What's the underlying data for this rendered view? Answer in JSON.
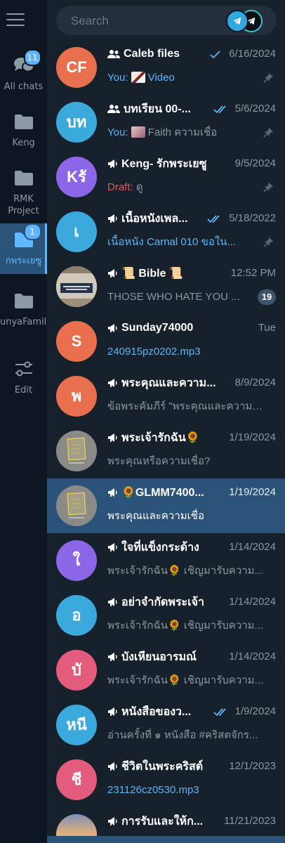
{
  "search": {
    "placeholder": "Search"
  },
  "folders": [
    {
      "label": "All chats",
      "icon": "chats-icon",
      "badge": "11"
    },
    {
      "label": "Keng",
      "icon": "folder-icon"
    },
    {
      "label": "RMK Project",
      "icon": "folder-icon"
    },
    {
      "label": "กพระเยซู",
      "icon": "folder-icon",
      "badge": "1",
      "active": true
    },
    {
      "label": "unyaFamily",
      "icon": "folder-icon"
    },
    {
      "label": "Edit",
      "icon": "sliders-icon"
    }
  ],
  "chats": [
    {
      "avatar": "CF",
      "color": "#e8704f",
      "icon": "group",
      "name": "Caleb files",
      "date": "6/16/2024",
      "ticks": "single",
      "sender": "You: ",
      "preview": "Video",
      "preview_style": "blue",
      "has_thumb": true,
      "pinned": true
    },
    {
      "avatar": "บท",
      "color": "#3ba9dc",
      "icon": "group",
      "name": "บทเรียน 00-...",
      "date": "5/6/2024",
      "ticks": "double",
      "sender": "You: ",
      "preview": "Faith ความเชื่อ",
      "has_thumb": true,
      "pinned": true
    },
    {
      "avatar": "Kรั",
      "color": "#8b66e6",
      "icon": "channel",
      "name": "Keng- รักพระเยซู",
      "date": "9/5/2024",
      "draft": "Draft: ",
      "preview": "ดู",
      "pinned": true
    },
    {
      "avatar": "เ",
      "color": "#3ba9dc",
      "icon": "channel",
      "name": "เนื้อหนังเพล...",
      "date": "5/18/2022",
      "ticks": "double",
      "preview": "เนื้อหนัง Carnal 010 ขอใน...",
      "preview_style": "blue",
      "pinned": true
    },
    {
      "avatar": "",
      "color": "#d8d6cf",
      "icon": "channel",
      "name": "📜 Bible 📜",
      "date": "12:52 PM",
      "preview": "THOSE WHO HATE YOU ...",
      "badge": "19",
      "image": "bible"
    },
    {
      "avatar": "S",
      "color": "#e8704f",
      "icon": "channel",
      "name": "Sunday74000",
      "date": "Tue",
      "preview": "240915pz0202.mp3",
      "preview_style": "blue"
    },
    {
      "avatar": "พ",
      "color": "#e8704f",
      "icon": "channel",
      "name": "พระคุณและความ...",
      "date": "8/9/2024",
      "preview": "ข้อพระคัมภีร์ \"พระคุณและความเชื่...\""
    },
    {
      "avatar": "",
      "color": "#7a7a7a",
      "icon": "channel",
      "name": "พระเจ้ารักฉัน🌻",
      "date": "1/19/2024",
      "preview": "พระคุณหรือความเชื่อ?",
      "image": "godbless"
    },
    {
      "avatar": "",
      "color": "#7a7a7a",
      "icon": "channel",
      "name": "🌻GLMM7400...",
      "date": "1/19/2024",
      "preview": "พระคุณและความเชื่อ",
      "image": "godbless",
      "selected": true
    },
    {
      "avatar": "ใ",
      "color": "#8b66e6",
      "icon": "channel",
      "name": "ใจที่แข็งกระด้าง",
      "date": "1/14/2024",
      "preview": "พระเจ้ารักฉัน🌻 เชิญมารับความ..."
    },
    {
      "avatar": "อ",
      "color": "#3ba9dc",
      "icon": "channel",
      "name": "อย่าจำกัดพระเจ้า",
      "date": "1/14/2024",
      "preview": "พระเจ้ารักฉัน🌻 เชิญมารับความ..."
    },
    {
      "avatar": "บั",
      "color": "#e35c7e",
      "icon": "channel",
      "name": "บังเหียนอารมณ์",
      "date": "1/14/2024",
      "preview": "พระเจ้ารักฉัน🌻 เชิญมารับความ..."
    },
    {
      "avatar": "หนี",
      "color": "#3ba9dc",
      "icon": "channel",
      "name": "หนังสือของว...",
      "date": "1/9/2024",
      "ticks": "double",
      "preview": "อ่านครั้งที่ ๑ หนังสือ #คริสตจักร..."
    },
    {
      "avatar": "ชี",
      "color": "#e35c7e",
      "icon": "channel",
      "name": "ชีวิตในพระคริสต์",
      "date": "12/1/2023",
      "preview": "231126cz0530.mp3",
      "preview_style": "blue"
    },
    {
      "avatar": "",
      "color": "#c98a5e",
      "icon": "channel",
      "name": "การรับและให้ก...",
      "date": "11/21/2023",
      "preview": "",
      "image": "sunset"
    }
  ]
}
